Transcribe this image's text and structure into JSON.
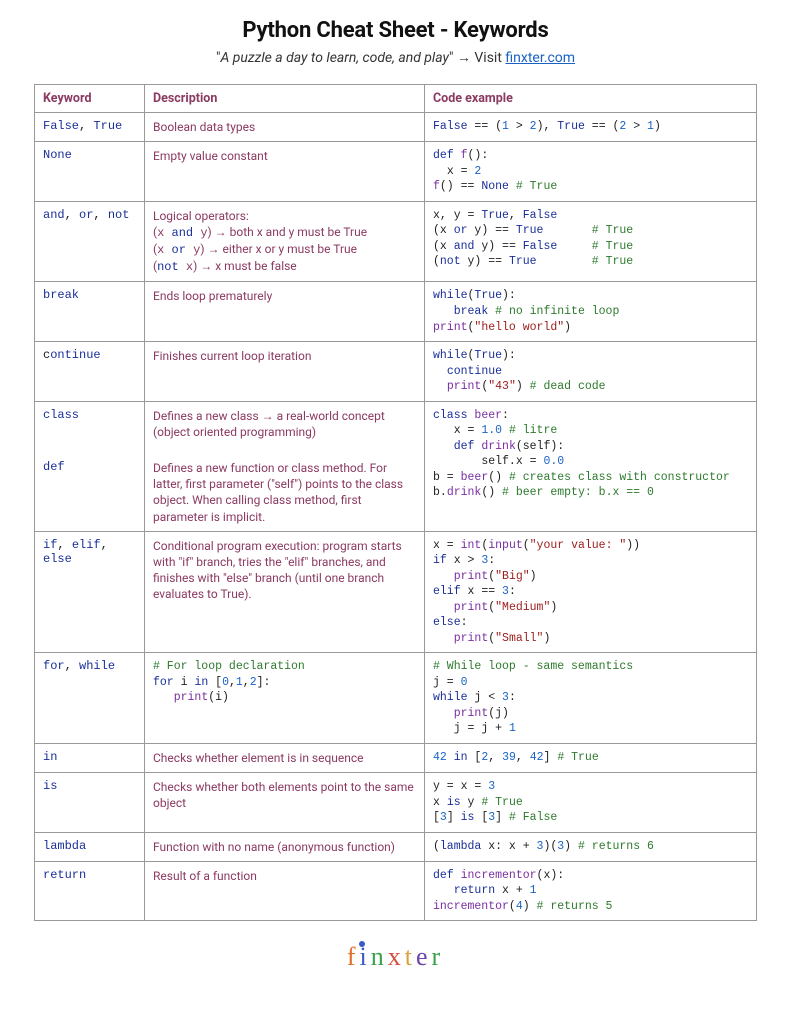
{
  "title": "Python Cheat Sheet - Keywords",
  "subtitle_quote": "A puzzle a day to learn, code, and play",
  "subtitle_visit": "Visit",
  "subtitle_link": "finxter.com",
  "headers": {
    "kw": "Keyword",
    "desc": "Description",
    "code": "Code example"
  },
  "rows": {
    "r1": {
      "kw_html": "<span class=\"c-kw\">False</span><span class=\"c-punc\">, </span><span class=\"c-kw\">True</span>",
      "desc_html": "Boolean data types",
      "code_html": "<span class=\"c-kw\">False</span> == (<span class=\"c-num\">1</span> &gt; <span class=\"c-num\">2</span>), <span class=\"c-kw\">True</span> == (<span class=\"c-num\">2</span> &gt; <span class=\"c-num\">1</span>)"
    },
    "r2": {
      "kw_html": "<span class=\"c-kw\">None</span>",
      "desc_html": "Empty value constant",
      "code_html": "<span class=\"c-kw\">def</span> <span class=\"c-fn\">f</span>():\n  x = <span class=\"c-num\">2</span>\n<span class=\"c-fn\">f</span>() == <span class=\"c-kw\">None</span> <span class=\"c-cmt\"># True</span>"
    },
    "r3": {
      "kw_html": "<span class=\"c-op\">and</span><span class=\"c-punc\">, </span><span class=\"c-op\">or</span><span class=\"c-punc\">, </span><span class=\"c-op\">not</span>",
      "desc_html": "Logical operators:<br>(<span class=\"mono\">x <span class=\"k\">and</span> y</span>) → both x and y must be True<br>(<span class=\"mono\">x <span class=\"k\">or</span> y</span>) → either x or y must be True<br>(<span class=\"mono\"><span class=\"k\">not</span> x</span>) → x must be false",
      "code_html": "x, y = <span class=\"c-kw\">True</span>, <span class=\"c-kw\">False</span>\n(x <span class=\"c-op\">or</span> y) == <span class=\"c-kw\">True</span>       <span class=\"c-cmt\"># True</span>\n(x <span class=\"c-op\">and</span> y) == <span class=\"c-kw\">False</span>     <span class=\"c-cmt\"># True</span>\n(<span class=\"c-op\">not</span> y) == <span class=\"c-kw\">True</span>        <span class=\"c-cmt\"># True</span>"
    },
    "r4": {
      "kw_html": "<span class=\"c-kw\">break</span>",
      "desc_html": "Ends loop prematurely",
      "code_html": "<span class=\"c-kw\">while</span>(<span class=\"c-kw\">True</span>):\n   <span class=\"c-kw\">break</span> <span class=\"c-cmt\"># no infinite loop</span>\n<span class=\"c-fn\">print</span>(<span class=\"c-str\">\"hello world\"</span>)"
    },
    "r5": {
      "kw_html": "c<span class=\"c-kw\">ontinue</span>",
      "desc_html": "Finishes current loop iteration",
      "code_html": "<span class=\"c-kw\">while</span>(<span class=\"c-kw\">True</span>):\n  <span class=\"c-kw\">continue</span>\n  <span class=\"c-fn\">print</span>(<span class=\"c-str\">\"43\"</span>) <span class=\"c-cmt\"># dead code</span>"
    },
    "r6a": {
      "kw_html": "<span class=\"c-kw\">class</span>",
      "desc_html": "Defines a new class → a real-world concept<br>(object oriented programming)",
      "code_html": "<span class=\"c-kw\">class</span> <span class=\"c-fn\">beer</span>:\n   x = <span class=\"c-num\">1.0</span> <span class=\"c-cmt\"># litre</span>\n   <span class=\"c-kw\">def</span> <span class=\"c-fn\">drink</span>(self):\n       self.x = <span class=\"c-num\">0.0</span>\nb = <span class=\"c-fn\">beer</span>() <span class=\"c-cmt\"># creates class with constructor</span>\nb.<span class=\"c-fn\">drink</span>() <span class=\"c-cmt\"># beer empty: b.x == 0</span>"
    },
    "r6b": {
      "kw_html": "<span class=\"c-kw\">def</span>",
      "desc_html": "Defines a new function or class method. For latter, first parameter (\"self\") points to the class object. When calling class method, first parameter is implicit."
    },
    "r7": {
      "kw_html": "<span class=\"c-kw\">if</span><span class=\"c-punc\">, </span><span class=\"c-kw\">elif</span><span class=\"c-punc\">, </span><span class=\"c-kw\">else</span>",
      "desc_html": "Conditional program execution: program starts with \"if\" branch, tries the \"elif\" branches, and finishes with \"else\" branch (until one branch evaluates to True).",
      "code_html": "x = <span class=\"c-fn\">int</span>(<span class=\"c-fn\">input</span>(<span class=\"c-str\">\"your value: \"</span>))\n<span class=\"c-kw\">if</span> x &gt; <span class=\"c-num\">3</span>:\n   <span class=\"c-fn\">print</span>(<span class=\"c-str\">\"Big\"</span>)\n<span class=\"c-kw\">elif</span> x == <span class=\"c-num\">3</span>:\n   <span class=\"c-fn\">print</span>(<span class=\"c-str\">\"Medium\"</span>)\n<span class=\"c-kw\">else</span>:\n   <span class=\"c-fn\">print</span>(<span class=\"c-str\">\"Small\"</span>)"
    },
    "r8": {
      "kw_html": "<span class=\"c-kw\">for</span><span class=\"c-punc\">, </span><span class=\"c-kw\">while</span>",
      "desc_html": "<pre><span class=\"c-cmt\"># For loop declaration</span>\n<span class=\"c-kw\">for</span> i <span class=\"c-op\">in</span> [<span class=\"c-num\">0</span>,<span class=\"c-num\">1</span>,<span class=\"c-num\">2</span>]:\n   <span class=\"c-fn\">print</span>(i)</pre>",
      "code_html": "<span class=\"c-cmt\"># While loop - same semantics</span>\nj = <span class=\"c-num\">0</span>\n<span class=\"c-kw\">while</span> j &lt; <span class=\"c-num\">3</span>:\n   <span class=\"c-fn\">print</span>(j)\n   j = j + <span class=\"c-num\">1</span>"
    },
    "r9": {
      "kw_html": "<span class=\"c-op\">in</span>",
      "desc_html": "Checks whether element is in sequence",
      "code_html": "<span class=\"c-num\">42</span> <span class=\"c-op\">in</span> [<span class=\"c-num\">2</span>, <span class=\"c-num\">39</span>, <span class=\"c-num\">42</span>] <span class=\"c-cmt\"># True</span>"
    },
    "r10": {
      "kw_html": "<span class=\"c-op\">is</span>",
      "desc_html": "Checks whether both elements point to the same object",
      "code_html": "y = x = <span class=\"c-num\">3</span>\nx <span class=\"c-op\">is</span> y <span class=\"c-cmt\"># True</span>\n[<span class=\"c-num\">3</span>] <span class=\"c-op\">is</span> [<span class=\"c-num\">3</span>] <span class=\"c-cmt\"># False</span>"
    },
    "r11": {
      "kw_html": "<span class=\"c-op\">lambda</span>",
      "desc_html": "Function with no name (anonymous function)",
      "code_html": "(<span class=\"c-op\">lambda</span> x: x + <span class=\"c-num\">3</span>)(<span class=\"c-num\">3</span>) <span class=\"c-cmt\"># returns 6</span>"
    },
    "r12": {
      "kw_html": "<span class=\"c-kw\">return</span>",
      "desc_html": "Result of a function",
      "code_html": "<span class=\"c-kw\">def</span> <span class=\"c-fn\">incrementor</span>(x):\n   <span class=\"c-kw\">return</span> x + <span class=\"c-num\">1</span>\n<span class=\"c-fn\">incrementor</span>(<span class=\"c-num\">4</span>) <span class=\"c-cmt\"># returns 5</span>"
    }
  },
  "footer": {
    "brand": "finxter"
  }
}
